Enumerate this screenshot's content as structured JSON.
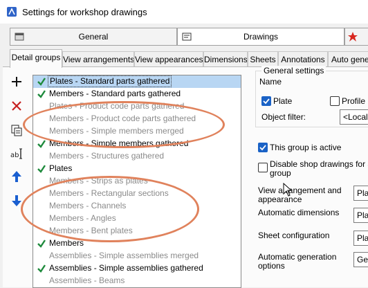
{
  "window": {
    "title": "Settings for workshop drawings"
  },
  "main_tabs": [
    {
      "label": "General"
    },
    {
      "label": "Drawings"
    }
  ],
  "sub_tabs": [
    {
      "label": "Detail groups"
    },
    {
      "label": "View arrangements"
    },
    {
      "label": "View appearances"
    },
    {
      "label": "Dimensions"
    },
    {
      "label": "Sheets"
    },
    {
      "label": "Annotations"
    },
    {
      "label": "Auto gener"
    }
  ],
  "list": {
    "items": [
      {
        "label": "Plates - Standard parts gathered",
        "checked": true,
        "selected": true,
        "dimmed": false
      },
      {
        "label": "Members - Standard parts gathered",
        "checked": true,
        "selected": false,
        "dimmed": false
      },
      {
        "label": "Plates - Product code parts gathered",
        "checked": false,
        "selected": false,
        "dimmed": true
      },
      {
        "label": "Members - Product code parts gathered",
        "checked": false,
        "selected": false,
        "dimmed": true
      },
      {
        "label": "Members - Simple members merged",
        "checked": false,
        "selected": false,
        "dimmed": true
      },
      {
        "label": "Members - Simple members gathered",
        "checked": true,
        "selected": false,
        "dimmed": false
      },
      {
        "label": "Members - Structures gathered",
        "checked": false,
        "selected": false,
        "dimmed": true
      },
      {
        "label": "Plates",
        "checked": true,
        "selected": false,
        "dimmed": false
      },
      {
        "label": "Members - Strips as plates",
        "checked": false,
        "selected": false,
        "dimmed": true
      },
      {
        "label": "Members - Rectangular sections",
        "checked": false,
        "selected": false,
        "dimmed": true
      },
      {
        "label": "Members - Channels",
        "checked": false,
        "selected": false,
        "dimmed": true
      },
      {
        "label": "Members - Angles",
        "checked": false,
        "selected": false,
        "dimmed": true
      },
      {
        "label": "Members - Bent plates",
        "checked": false,
        "selected": false,
        "dimmed": true
      },
      {
        "label": "Members",
        "checked": true,
        "selected": false,
        "dimmed": false
      },
      {
        "label": "Assemblies - Simple assemblies merged",
        "checked": false,
        "selected": false,
        "dimmed": true
      },
      {
        "label": "Assemblies - Simple assemblies gathered",
        "checked": true,
        "selected": false,
        "dimmed": false
      },
      {
        "label": "Assemblies - Beams",
        "checked": false,
        "selected": false,
        "dimmed": true
      }
    ]
  },
  "general_settings": {
    "legend": "General settings",
    "name_label": "Name",
    "plate_label": "Plate",
    "plate_checked": true,
    "profile_label": "Profile",
    "profile_checked": false,
    "object_filter_label": "Object filter:",
    "object_filter_value": "<Local"
  },
  "group_active": {
    "label": "This group is active",
    "checked": true
  },
  "disable_shop": {
    "label_line1": "Disable shop drawings for all i",
    "label_line2": "group",
    "checked": false
  },
  "settings": {
    "view_arrangement_line1": "View arrangement and",
    "view_arrangement_line2": "appearance",
    "view_arrangement_value": "Plat",
    "automatic_dimensions": "Automatic dimensions",
    "automatic_dimensions_value": "Plat",
    "sheet_configuration": "Sheet configuration",
    "sheet_configuration_value": "Plat",
    "automatic_generation_line1": "Automatic generation",
    "automatic_generation_line2": "options",
    "automatic_generation_value": "Gen"
  },
  "colors": {
    "accent": "#1a62c6",
    "annotation_oval": "#e0825c",
    "selection": "#b8d6f3",
    "check_green": "#1e8a3c"
  }
}
